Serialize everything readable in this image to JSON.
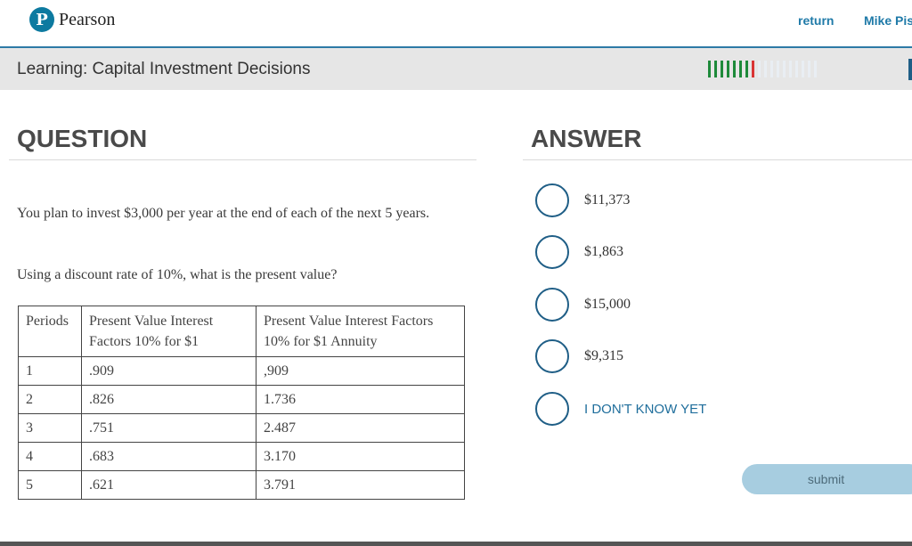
{
  "header": {
    "logo_text": "Pearson",
    "logo_letter": "P",
    "return_label": "return",
    "user_name": "Mike Pisc"
  },
  "subheader": {
    "title": "Learning: Capital Investment Decisions",
    "progress": {
      "completed": 8,
      "incorrect_index": 7,
      "total": 18
    }
  },
  "question": {
    "heading": "QUESTION",
    "paragraph1": "You plan to invest $3,000 per year at the end of each of the next 5 years.",
    "paragraph2": "Using a discount rate of 10%, what is the present value?",
    "table": {
      "headers": [
        "Periods",
        "Present Value Interest Factors 10% for $1",
        "Present Value Interest Factors 10% for $1 Annuity"
      ],
      "rows": [
        [
          "1",
          ".909",
          ",909"
        ],
        [
          "2",
          ".826",
          "1.736"
        ],
        [
          "3",
          ".751",
          "2.487"
        ],
        [
          "4",
          ".683",
          "3.170"
        ],
        [
          "5",
          ".621",
          "3.791"
        ]
      ]
    }
  },
  "answer": {
    "heading": "ANSWER",
    "choices": [
      "$11,373",
      "$1,863",
      "$15,000",
      "$9,315",
      "I DON'T KNOW YET"
    ]
  },
  "submit_label": "submit",
  "colors": {
    "accent": "#1f7aa8",
    "progress_correct": "#1e8a3a",
    "progress_incorrect": "#d93535",
    "submit_bg": "#a7cde0"
  }
}
